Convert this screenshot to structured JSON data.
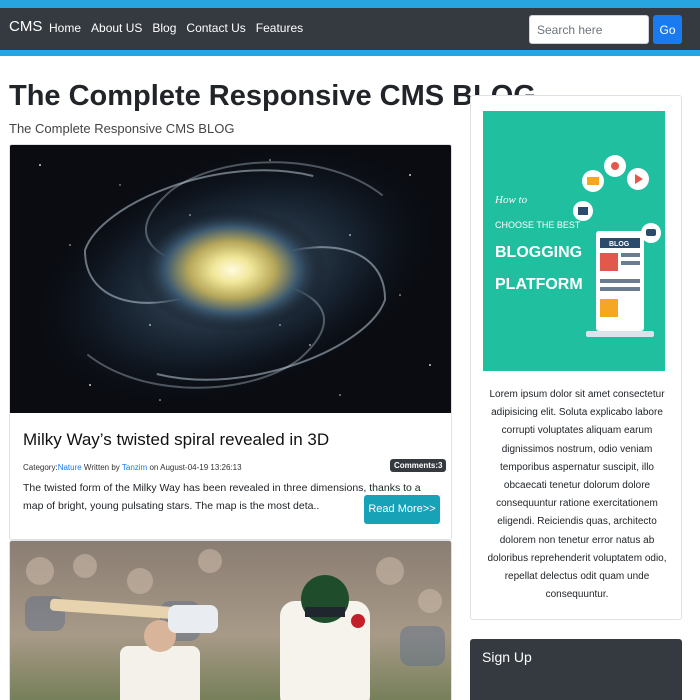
{
  "nav": {
    "brand": "CMS",
    "links": [
      "Home",
      "About US",
      "Blog",
      "Contact Us",
      "Features"
    ],
    "search_placeholder": "Search here",
    "go_label": "Go"
  },
  "page": {
    "title": "The Complete Responsive CMS BLOG",
    "subtitle": "The Complete Responsive CMS BLOG"
  },
  "post": {
    "title": "Milky Way’s twisted spiral revealed in 3D",
    "category_label": "Category:",
    "category": "Nature",
    "written_by_label": " Written by ",
    "author": "Tanzim",
    "date_prefix": " on ",
    "date": "August-04-19 13:26:13",
    "comments": "Comments:3",
    "excerpt": "The twisted form of the Milky Way has been revealed in three dimensions, thanks to a map of bright, young pulsating stars. The map is the most deta..",
    "read_more": "Read More>>"
  },
  "sidebar": {
    "promo_lines": [
      "How to",
      "CHOOSE THE BEST",
      "BLOGGING",
      "PLATFORM",
      "BLOG"
    ],
    "text": "Lorem ipsum dolor sit amet consectetur adipisicing elit. Soluta explicabo labore corrupti voluptates aliquam earum dignissimos nostrum, odio veniam temporibus aspernatur suscipit, illo obcaecati tenetur dolorum dolore consequuntur ratione exercitationem eligendi. Reiciendis quas, architecto dolorem non tenetur error natus ab doloribus reprehenderit voluptatem odio, repellat delectus odit quam unde consequuntur.",
    "signup_title": "Sign Up"
  },
  "colors": {
    "accent": "#27a5e0",
    "navbar": "#343a40",
    "button_primary": "#1a7bf0",
    "button_info": "#17a2b8",
    "promo_bg": "#1fbf9f"
  }
}
